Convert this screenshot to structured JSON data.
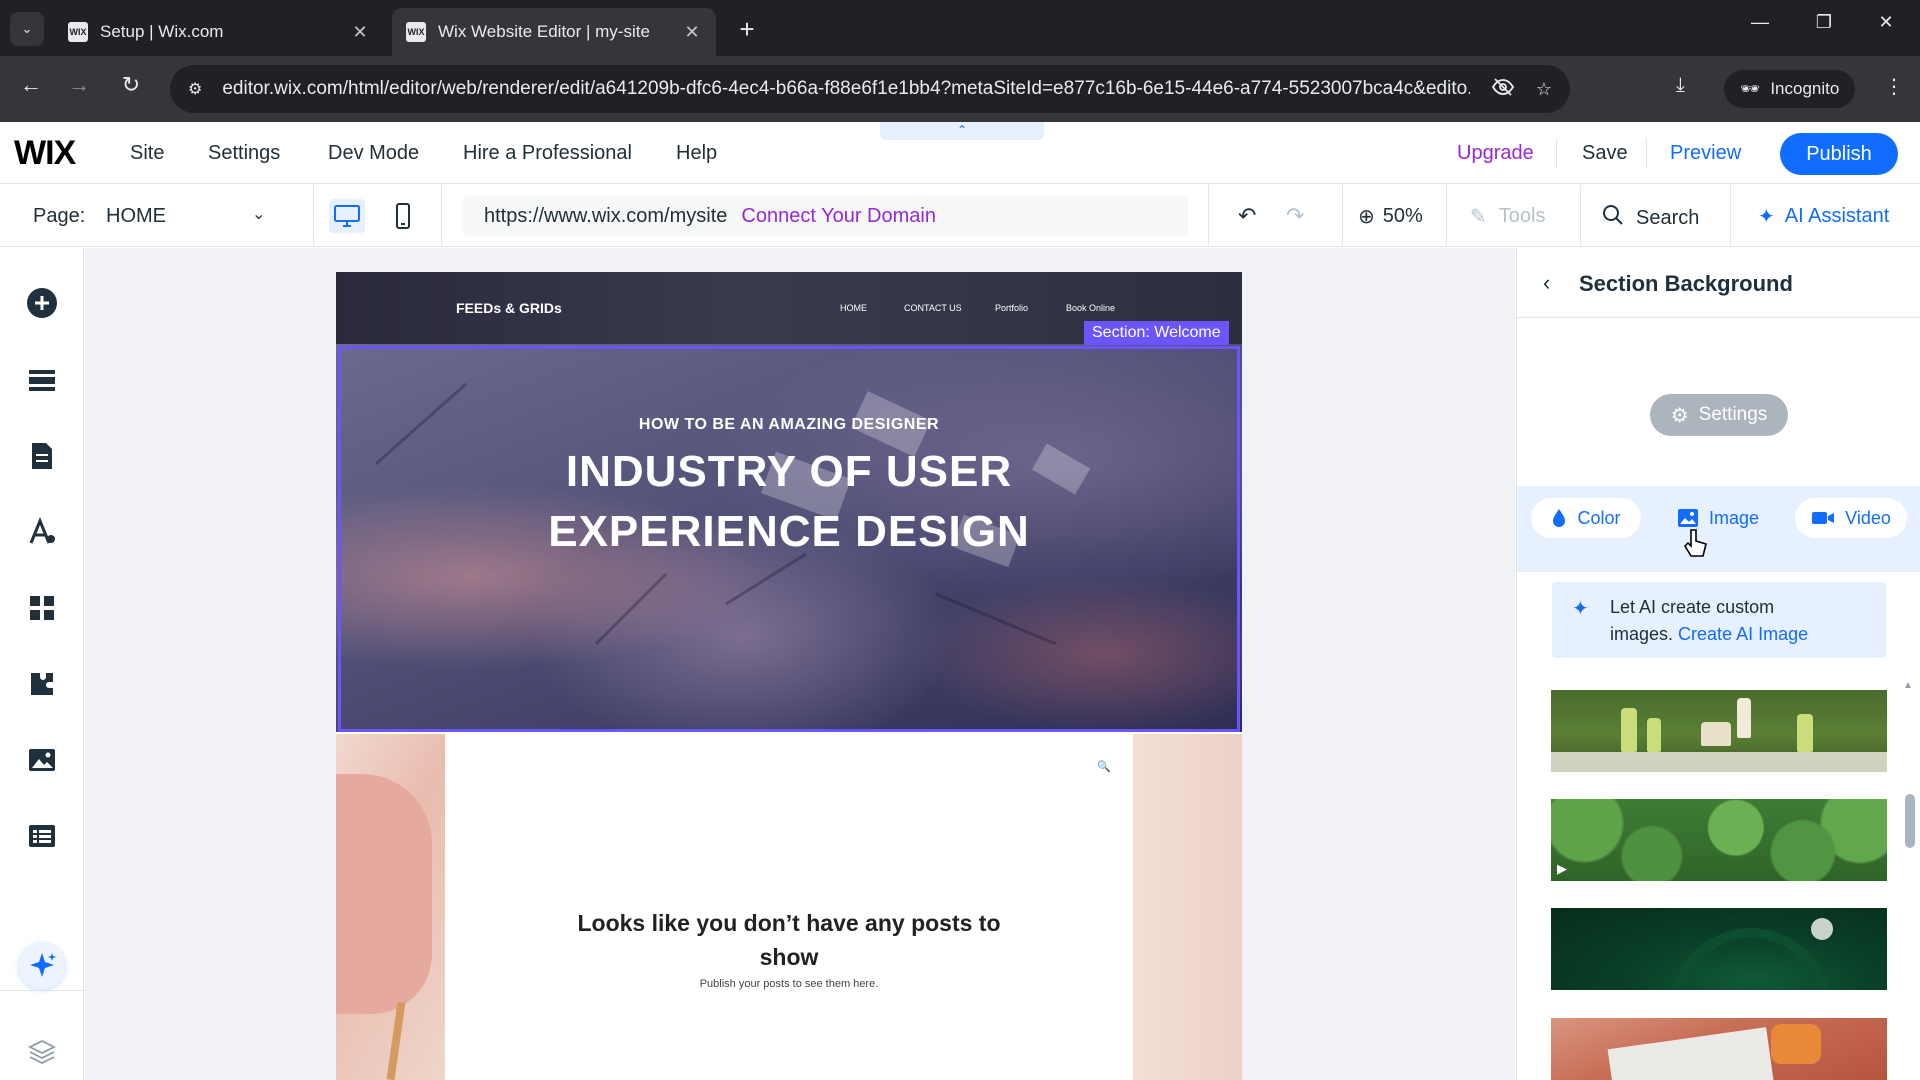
{
  "browser": {
    "tabs": [
      {
        "favicon": "WIX",
        "title": "Setup | Wix.com",
        "active": false
      },
      {
        "favicon": "WIX",
        "title": "Wix Website Editor | my-site",
        "active": true
      }
    ],
    "address": "editor.wix.com/html/editor/web/renderer/edit/a641209b-dfc6-4ec4-b66a-f88e6f1e1bb4?metaSiteId=e877c16b-6e15-44e6-a774-5523007bca4c&edito...",
    "incognito_label": "Incognito"
  },
  "wix_top": {
    "logo": "WIX",
    "menu": [
      "Site",
      "Settings",
      "Dev Mode",
      "Hire a Professional",
      "Help"
    ],
    "upgrade": "Upgrade",
    "save": "Save",
    "preview": "Preview",
    "publish": "Publish"
  },
  "wix_sub": {
    "page_label": "Page:",
    "page_value": "HOME",
    "site_url": "https://www.wix.com/mysite",
    "connect_domain": "Connect Your Domain",
    "zoom": "50%",
    "tools": "Tools",
    "search": "Search",
    "ai_assistant": "AI Assistant"
  },
  "site": {
    "logo": "FEEDs & GRIDs",
    "nav": [
      "HOME",
      "CONTACT US",
      "Portfolio",
      "Book Online"
    ],
    "section_tag": "Section: Welcome",
    "hero_subtitle": "HOW TO BE AN AMAZING DESIGNER",
    "hero_title_line1": "INDUSTRY OF USER",
    "hero_title_line2": "EXPERIENCE DESIGN",
    "blog_empty_line1": "Looks like you don’t have any posts to",
    "blog_empty_line2": "show",
    "blog_empty_sub": "Publish your posts to see them here."
  },
  "panel": {
    "title": "Section Background",
    "settings": "Settings",
    "tabs": [
      "Color",
      "Image",
      "Video"
    ],
    "ai_text_line1": "Let AI create custom",
    "ai_text_line2": "images.",
    "ai_link": "Create AI Image"
  },
  "colors": {
    "wix_blue": "#116dff",
    "upgrade_purple": "#9a27d5",
    "selection_purple": "#6b55ff"
  }
}
